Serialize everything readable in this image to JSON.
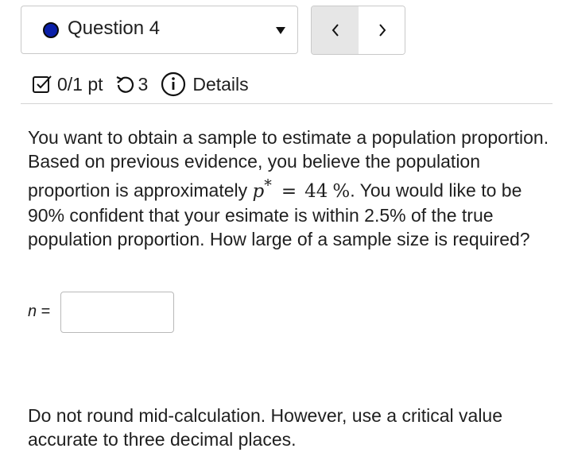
{
  "question_selector": {
    "label": "Question 4",
    "status_color": "#0a1fa8"
  },
  "nav": {
    "prev_icon": "chevron-left-icon",
    "next_icon": "chevron-right-icon"
  },
  "meta": {
    "score": "0/1 pt",
    "attempts": "3",
    "details_label": "Details"
  },
  "question": {
    "text_before": "You want to obtain a sample to estimate a population proportion. Based on previous evidence, you believe the population proportion is approximately ",
    "math_symbol": "p",
    "math_superscript": "*",
    "math_equals": "=",
    "math_value": "44",
    "math_unit": "%",
    "text_after": ". You would like to be 90% confident that your esimate is within 2.5% of the true population proportion. How large of a sample size is required?"
  },
  "answer": {
    "label_var": "n",
    "label_eq": " =",
    "value": ""
  },
  "note": "Do not round mid-calculation. However, use a critical value accurate to three decimal places."
}
